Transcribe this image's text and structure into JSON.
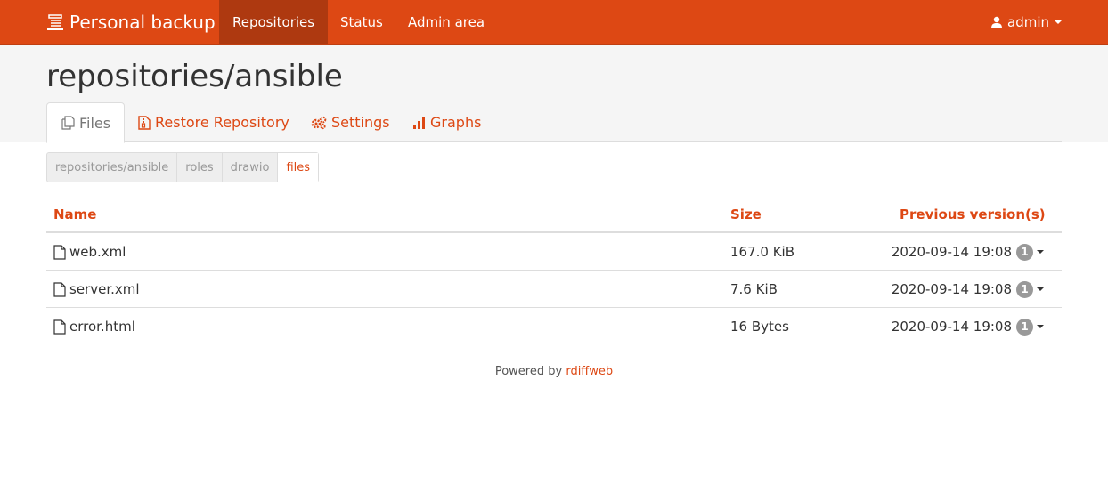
{
  "navbar": {
    "brand": "Personal backup",
    "links": [
      "Repositories",
      "Status",
      "Admin area"
    ],
    "user": "admin"
  },
  "page": {
    "title": "repositories/ansible"
  },
  "tabs": [
    "Files",
    "Restore Repository",
    "Settings",
    "Graphs"
  ],
  "breadcrumb": [
    "repositories/ansible",
    "roles",
    "drawio",
    "files"
  ],
  "table": {
    "headers": {
      "name": "Name",
      "size": "Size",
      "versions": "Previous version(s)"
    },
    "rows": [
      {
        "name": "web.xml",
        "size": "167.0 KiB",
        "date": "2020-09-14 19:08",
        "count": "1"
      },
      {
        "name": "server.xml",
        "size": "7.6 KiB",
        "date": "2020-09-14 19:08",
        "count": "1"
      },
      {
        "name": "error.html",
        "size": "16 Bytes",
        "date": "2020-09-14 19:08",
        "count": "1"
      }
    ]
  },
  "footer": {
    "prefix": "Powered by",
    "link": "rdiffweb"
  },
  "colors": {
    "accent": "#dd4814",
    "nav_active": "#ae3910",
    "badge": "#999999"
  },
  "icons": {
    "brand": "database-icon",
    "user": "user-icon",
    "files": "files-icon",
    "restore": "file-archive-icon",
    "settings": "cogs-icon",
    "graphs": "bar-chart-icon",
    "file": "file-icon"
  }
}
